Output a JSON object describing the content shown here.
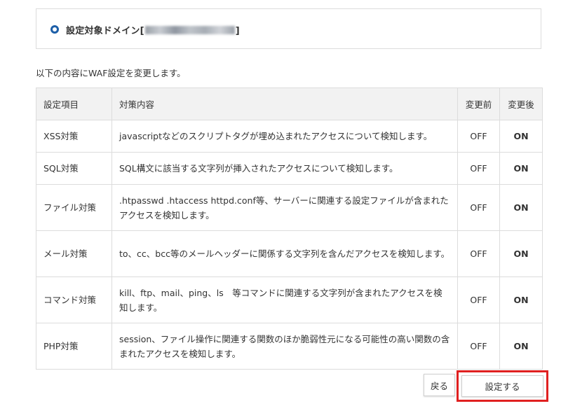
{
  "domain_section": {
    "label_prefix": "設定対象ドメイン[",
    "label_suffix": "]",
    "domain_value": "■■■■■■■■■■■■■■"
  },
  "intro_text": "以下の内容にWAF設定を変更します。",
  "table": {
    "headers": [
      "設定項目",
      "対策内容",
      "変更前",
      "変更後"
    ],
    "rows": [
      {
        "item": "XSS対策",
        "desc": "javascriptなどのスクリプトタグが埋め込まれたアクセスについて検知します。",
        "before": "OFF",
        "after": "ON"
      },
      {
        "item": "SQL対策",
        "desc": "SQL構文に該当する文字列が挿入されたアクセスについて検知します。",
        "before": "OFF",
        "after": "ON"
      },
      {
        "item": "ファイル対策",
        "desc": ".htpasswd .htaccess httpd.conf等、サーバーに関連する設定ファイルが含まれたアクセスを検知します。",
        "before": "OFF",
        "after": "ON"
      },
      {
        "item": "メール対策",
        "desc": "to、cc、bcc等のメールヘッダーに関係する文字列を含んだアクセスを検知します。",
        "before": "OFF",
        "after": "ON"
      },
      {
        "item": "コマンド対策",
        "desc": "kill、ftp、mail、ping、ls　等コマンドに関連する文字列が含まれたアクセスを検知します。",
        "before": "OFF",
        "after": "ON"
      },
      {
        "item": "PHP対策",
        "desc": "session、ファイル操作に関連する関数のほか脆弱性元になる可能性の高い関数の含まれたアクセスを検知します。",
        "before": "OFF",
        "after": "ON"
      }
    ]
  },
  "buttons": {
    "back_label": "戻る",
    "submit_label": "設定する"
  },
  "colors": {
    "accent": "#1d5fa8",
    "highlight": "#e02020",
    "header_bg": "#f2f2f2",
    "border": "#dcdcdc"
  }
}
